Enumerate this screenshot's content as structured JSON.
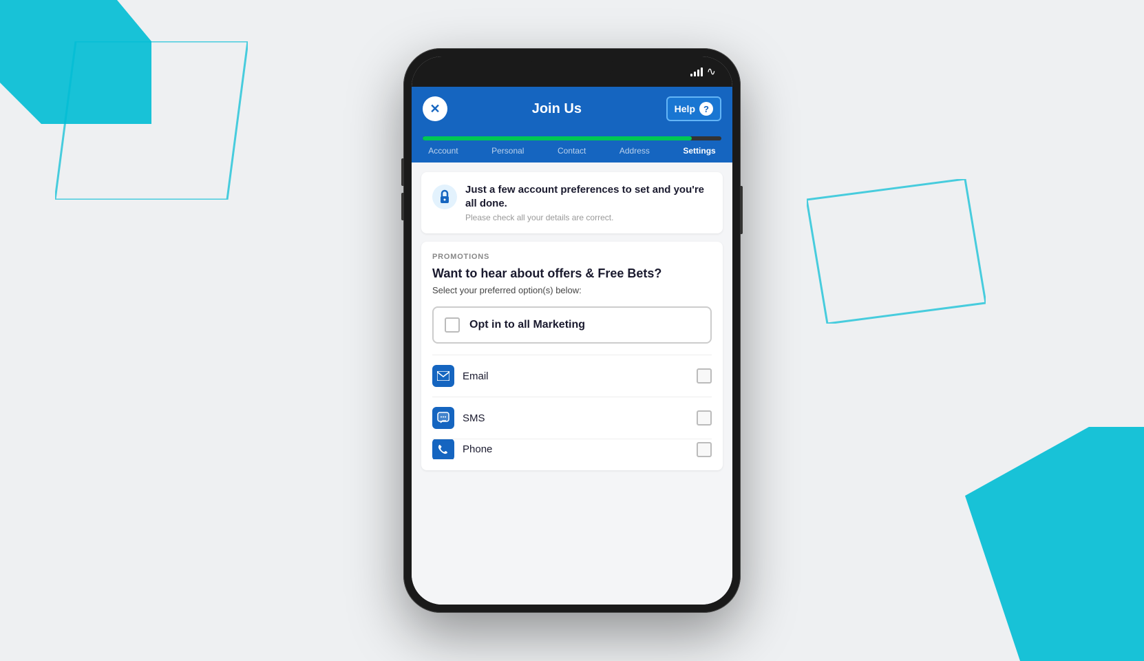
{
  "background": {
    "color": "#eef0f2"
  },
  "header": {
    "title": "Join Us",
    "close_label": "✕",
    "help_label": "Help",
    "help_question": "?"
  },
  "progress": {
    "fill_percent": 90
  },
  "steps": [
    {
      "id": "account",
      "label": "Account",
      "active": false
    },
    {
      "id": "personal",
      "label": "Personal",
      "active": false
    },
    {
      "id": "contact",
      "label": "Contact",
      "active": false
    },
    {
      "id": "address",
      "label": "Address",
      "active": false
    },
    {
      "id": "settings",
      "label": "Settings",
      "active": true
    }
  ],
  "info_card": {
    "title": "Just a few account preferences to set and you're all done.",
    "subtitle": "Please check all your details are correct."
  },
  "promotions": {
    "section_label": "PROMOTIONS",
    "title": "Want to hear about offers & Free Bets?",
    "subtitle": "Select your preferred option(s) below:",
    "opt_in_all_label": "Opt in to all Marketing",
    "channels": [
      {
        "id": "email",
        "label": "Email",
        "icon": "email"
      },
      {
        "id": "sms",
        "label": "SMS",
        "icon": "sms"
      },
      {
        "id": "phone",
        "label": "Phone",
        "icon": "phone"
      }
    ]
  },
  "status_bar": {
    "signal_bars": [
      4,
      6,
      8,
      10,
      12
    ],
    "wifi": "wifi"
  }
}
